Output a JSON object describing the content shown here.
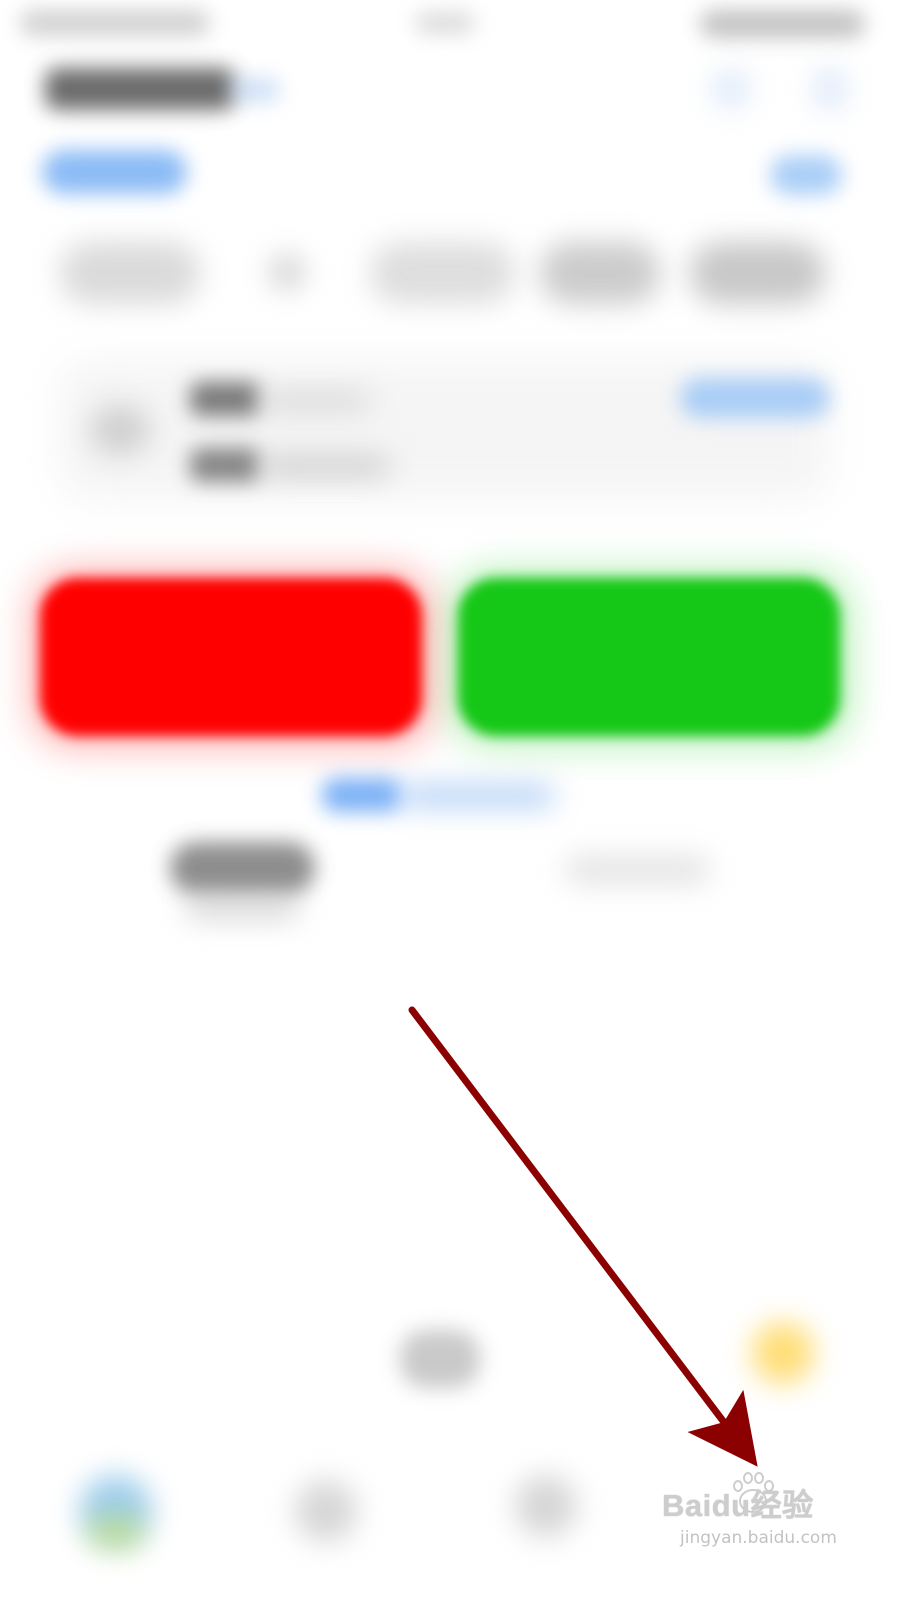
{
  "screen": {
    "blurred": true
  },
  "status_bar": {
    "left": "status-text",
    "center": "status-center",
    "right": "status-icons"
  },
  "header": {
    "title": "",
    "right_icons": [
      "icon-a",
      "icon-b"
    ]
  },
  "actions": {
    "red_button_color": "#ff0000",
    "green_button_color": "#15c716"
  },
  "annotation": {
    "arrow_color": "#8b0000",
    "pointing_to": "bottom-right-nav"
  },
  "watermark": {
    "line1": "Baidu经验",
    "line2": "jingyan.baidu.com"
  }
}
